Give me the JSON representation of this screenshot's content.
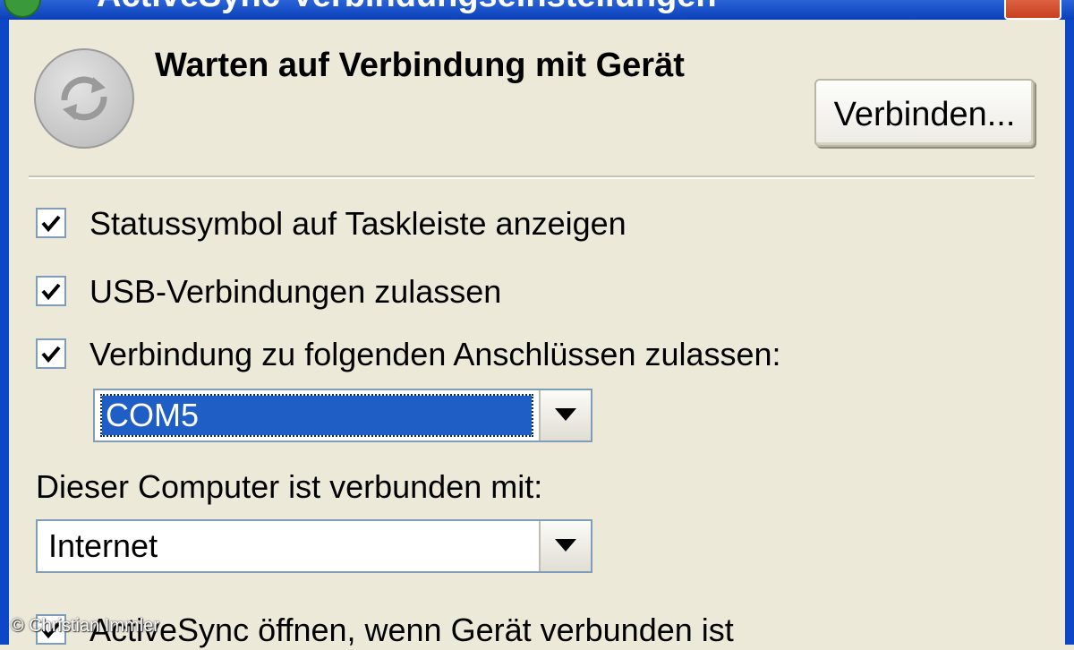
{
  "window": {
    "title": "ActiveSync-Verbindungseinstellungen"
  },
  "header": {
    "status_text": "Warten auf Verbindung mit Gerät",
    "connect_button_label": "Verbinden..."
  },
  "options": [
    {
      "label": "Statussymbol auf Taskleiste anzeigen",
      "checked": true
    },
    {
      "label": "USB-Verbindungen zulassen",
      "checked": true
    },
    {
      "label": "Verbindung zu folgenden Anschlüssen zulassen:",
      "checked": true
    },
    {
      "label": "ActiveSync öffnen, wenn Gerät verbunden ist",
      "checked": true
    }
  ],
  "port_select": {
    "value": "COM5"
  },
  "connected_to": {
    "label": "Dieser Computer ist verbunden mit:",
    "value": "Internet"
  },
  "watermark": "© Christian Immler",
  "colors": {
    "dialog_bg": "#ece9d8",
    "titlebar_blue": "#0a3fb8",
    "selection_blue": "#1f5fc5",
    "field_border": "#7f9db9"
  }
}
